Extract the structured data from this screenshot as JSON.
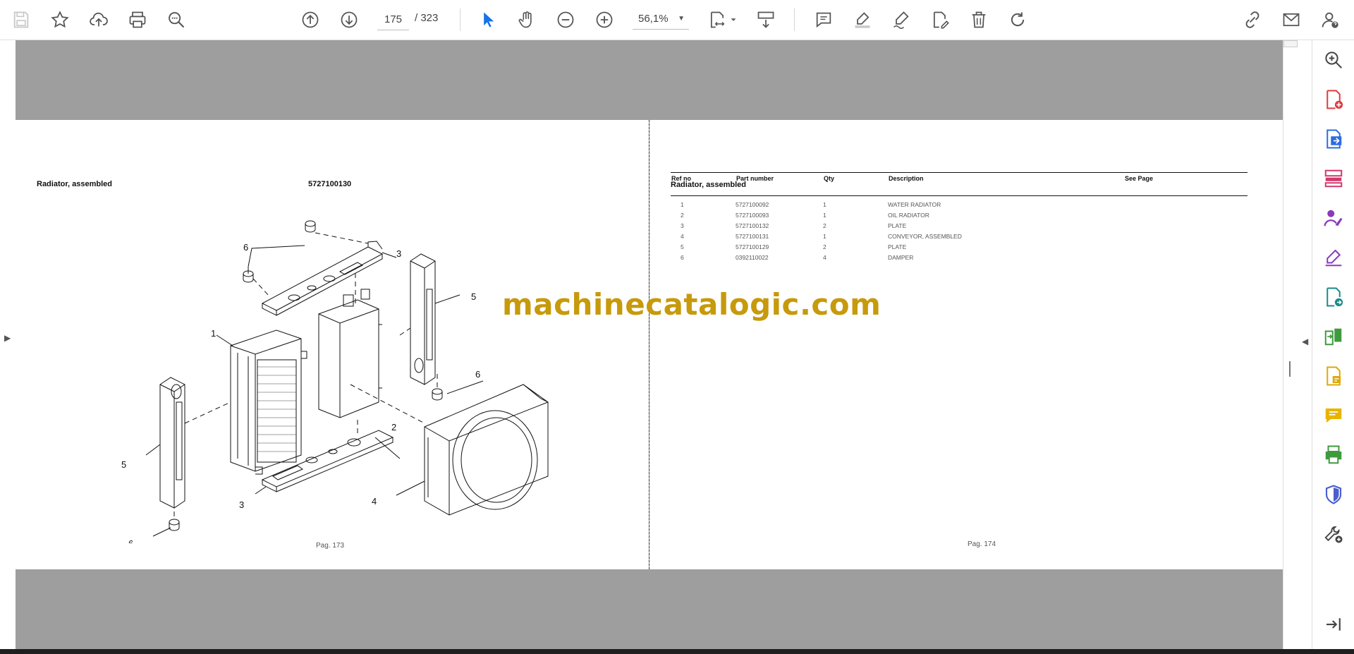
{
  "toolbar": {
    "current_page": "175",
    "total_pages": "/ 323",
    "zoom": "56,1%",
    "icons_left": [
      "save-icon",
      "bookmark-star-icon",
      "upload-cloud-icon",
      "print-icon",
      "search-zoom-icon"
    ],
    "icons_nav": [
      "page-up-icon",
      "page-down-icon"
    ],
    "icons_tools": [
      "select-cursor-icon",
      "hand-pan-icon",
      "zoom-out-icon",
      "zoom-in-icon"
    ],
    "icons_right": [
      "comment-icon",
      "highlight-icon",
      "draw-sign-icon",
      "edit-pdf-icon",
      "delete-icon",
      "rotate-icon"
    ],
    "icons_far_right": [
      "share-link-icon",
      "email-icon",
      "account-help-icon"
    ]
  },
  "left_page": {
    "title": "Radiator, assembled",
    "part_number": "5727100130",
    "footer": "Pag. 173",
    "callouts": [
      "6",
      "3",
      "5",
      "1",
      "6",
      "2",
      "5",
      "3",
      "4",
      "6"
    ]
  },
  "right_page": {
    "title": "Radiator, assembled",
    "footer": "Pag. 174",
    "columns": [
      "Ref no",
      "Part number",
      "Qty",
      "Description",
      "See Page"
    ],
    "rows": [
      [
        "1",
        "5727100092",
        "1",
        "WATER RADIATOR",
        ""
      ],
      [
        "2",
        "5727100093",
        "1",
        "OIL RADIATOR",
        ""
      ],
      [
        "3",
        "5727100132",
        "2",
        "PLATE",
        ""
      ],
      [
        "4",
        "5727100131",
        "1",
        "CONVEYOR, ASSEMBLED",
        ""
      ],
      [
        "5",
        "5727100129",
        "2",
        "PLATE",
        ""
      ],
      [
        "6",
        "0392110022",
        "4",
        "DAMPER",
        ""
      ]
    ]
  },
  "watermark": "machinecatalogic.com",
  "right_panel_icons": [
    "zoom-search-icon",
    "create-pdf-icon",
    "export-pdf-icon",
    "organize-pages-icon",
    "request-signature-icon",
    "fill-sign-icon",
    "send-for-review-icon",
    "compare-files-icon",
    "scan-ocr-icon",
    "comment-tool-icon",
    "print-production-icon",
    "protect-shield-icon",
    "more-tools-icon",
    "collapse-panel-icon"
  ],
  "colors": {
    "accent_blue": "#1473e6",
    "viewport_gray": "#9e9e9e",
    "watermark_gold": "#c79a0c"
  }
}
